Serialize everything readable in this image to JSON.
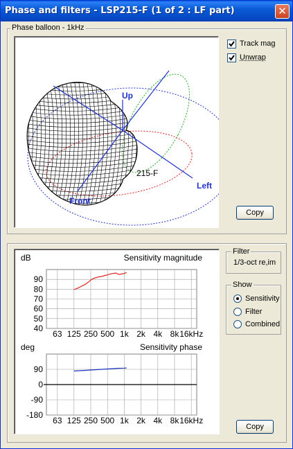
{
  "window": {
    "title": "Phase and filters - LSP215-F (1 of 2 : LF part)",
    "close_symbol": "✕"
  },
  "balloon_panel": {
    "group_label": "Phase balloon - 1kHz",
    "track_mag": {
      "label": "Track mag",
      "checked": true
    },
    "unwrap": {
      "label": "Unwrap",
      "checked": true
    },
    "axis_labels": {
      "up": "Up",
      "left": "Left",
      "front": "Front",
      "model": "215-F"
    },
    "copy_label": "Copy"
  },
  "filter_group": {
    "label": "Filter",
    "value": "1/3-oct re,im"
  },
  "show_group": {
    "label": "Show",
    "options": [
      {
        "label": "Sensitivity",
        "checked": true
      },
      {
        "label": "Filter",
        "checked": false
      },
      {
        "label": "Combined",
        "checked": false
      }
    ]
  },
  "bottom_copy_label": "Copy",
  "colors": {
    "magnitude": "#dd2222",
    "phase": "#1a2fbf",
    "axis_blue": "#2233cc",
    "grid": "#a0a0a0"
  },
  "chart_data": [
    {
      "type": "line",
      "title": "Sensitivity magnitude",
      "ylabel": "dB",
      "xlabel": "",
      "x_scale": "log",
      "xlim": [
        40,
        20000
      ],
      "ylim": [
        40,
        100
      ],
      "x_ticks": [
        63,
        125,
        250,
        500,
        1000,
        2000,
        4000,
        8000,
        16000
      ],
      "x_tick_labels": [
        "63",
        "125",
        "250",
        "500",
        "1k",
        "2k",
        "4k",
        "8k",
        "16kHz"
      ],
      "y_ticks": [
        90,
        80,
        70,
        60,
        50,
        40
      ],
      "y_tick_labels": [
        "90",
        "80",
        "70",
        "60",
        "50",
        "40"
      ],
      "grid": true,
      "series": [
        {
          "x": [
            125,
            145,
            170,
            200,
            230,
            260,
            300,
            350,
            400,
            450,
            500,
            560,
            630,
            710,
            800,
            900,
            1000,
            1100
          ],
          "y": [
            79.5,
            81,
            83,
            85,
            87.5,
            90,
            91.5,
            92.5,
            93,
            94,
            94.5,
            95.5,
            96,
            96.5,
            95,
            95.5,
            96,
            97
          ]
        }
      ]
    },
    {
      "type": "line",
      "title": "Sensitivity phase",
      "ylabel": "deg",
      "xlabel": "",
      "x_scale": "log",
      "xlim": [
        40,
        20000
      ],
      "ylim": [
        -180,
        180
      ],
      "x_ticks": [
        63,
        125,
        250,
        500,
        1000,
        2000,
        4000,
        8000,
        16000
      ],
      "x_tick_labels": [
        "63",
        "125",
        "250",
        "500",
        "1k",
        "2k",
        "4k",
        "8k",
        "16kHz"
      ],
      "y_ticks": [
        90,
        0,
        -90,
        -180
      ],
      "y_tick_labels": [
        "90",
        "0",
        "-90",
        "-180"
      ],
      "grid": true,
      "series": [
        {
          "x": [
            125,
            160,
            200,
            250,
            315,
            400,
            500,
            630,
            800,
            1000,
            1100
          ],
          "y": [
            80,
            82,
            84,
            86,
            88,
            90,
            92,
            94,
            96,
            97,
            98
          ]
        }
      ]
    }
  ]
}
